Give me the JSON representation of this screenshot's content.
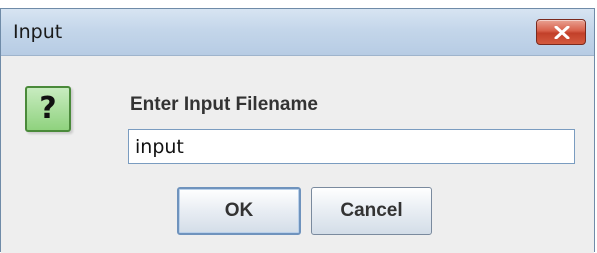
{
  "dialog": {
    "title": "Input",
    "close_icon": "close-x-icon",
    "question_icon": "question-icon",
    "question_glyph": "?",
    "prompt": "Enter Input Filename",
    "input_value": "input",
    "ok_label": "OK",
    "cancel_label": "Cancel"
  },
  "colors": {
    "title_bar": "#c4d6ea",
    "close_button": "#d8604a",
    "question_icon_bg": "#8fd27e",
    "dialog_bg": "#eeeeee"
  }
}
